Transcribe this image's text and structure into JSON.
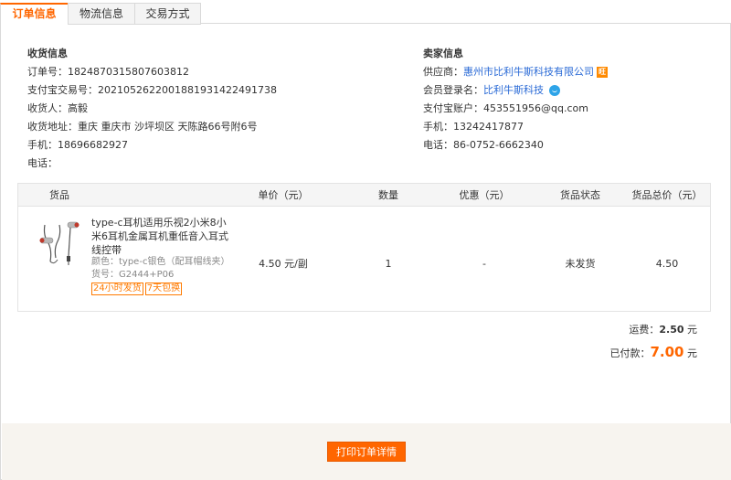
{
  "tabs": [
    {
      "label": "订单信息",
      "active": true
    },
    {
      "label": "物流信息",
      "active": false
    },
    {
      "label": "交易方式",
      "active": false
    }
  ],
  "receiver": {
    "heading": "收货信息",
    "rows": [
      {
        "label": "订单号：",
        "value": "1824870315807603812"
      },
      {
        "label": "支付宝交易号：",
        "value": "2021052622001881931422491738"
      },
      {
        "label": "收货人：",
        "value": "高毅"
      },
      {
        "label": "收货地址：",
        "value": "重庆 重庆市 沙坪坝区 天陈路66号附6号"
      },
      {
        "label": "手机：",
        "value": "18696682927"
      },
      {
        "label": "电话：",
        "value": ""
      }
    ]
  },
  "seller": {
    "heading": "卖家信息",
    "supplier_label": "供应商：",
    "supplier_value": "惠州市比利牛斯科技有限公司",
    "supplier_badge": "旺",
    "member_label": "会员登录名：",
    "member_value": "比利牛斯科技",
    "alipay_label": "支付宝账户：",
    "alipay_value": "453551956@qq.com",
    "mobile_label": "手机：",
    "mobile_value": "13242417877",
    "phone_label": "电话：",
    "phone_value": "86-0752-6662340"
  },
  "table": {
    "headers": [
      "货品",
      "单价（元）",
      "数量",
      "优惠（元）",
      "货品状态",
      "货品总价（元）"
    ],
    "item": {
      "title": "type-c耳机适用乐视2小米8小米6耳机金属耳机重低音入耳式 线控带",
      "color": "颜色：type-c银色（配耳帽线夹）",
      "sku": "货号：G2444+P06",
      "tags": [
        "24小时发货",
        "7天包换"
      ],
      "unit_price": "4.50 元/副",
      "quantity": "1",
      "discount": "-",
      "status": "未发货",
      "total": "4.50"
    }
  },
  "summary": {
    "shipping_label": "运费：",
    "shipping_value": "2.50",
    "shipping_unit": "元",
    "paid_label": "已付款：",
    "paid_value": "7.00",
    "paid_unit": "元"
  },
  "footer": {
    "print_button": "打印订单详情"
  },
  "colors": {
    "accent": "#ff6600",
    "link": "#2a6ad6",
    "footer_bg": "#f7f4ef"
  }
}
